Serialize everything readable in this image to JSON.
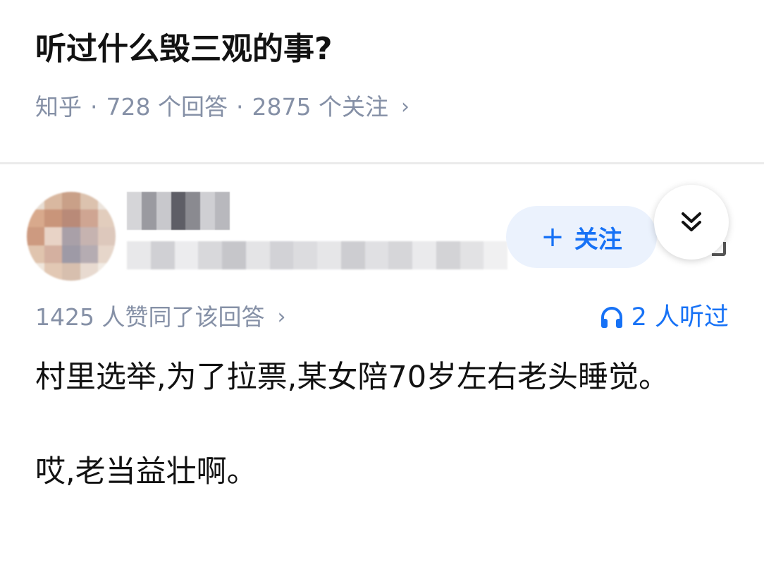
{
  "question": {
    "title": "听过什么毁三观的事?",
    "source": "知乎",
    "dot": "·",
    "answer_count": "728 个回答",
    "follower_count": "2875 个关注",
    "chevron": "›"
  },
  "author": {
    "follow_label": "关注",
    "follow_icon": "plus-icon",
    "collapse_icon": "double-chevron-down-icon"
  },
  "stats": {
    "votes_text": "1425 人赞同了该回答",
    "chevron": "›",
    "listen_icon": "headphones-icon",
    "listen_text": "2 人听过"
  },
  "answer": {
    "paragraphs": [
      "村里选举,为了拉票,某女陪70岁左右老头睡觉。",
      "哎,老当益壮啊。"
    ]
  },
  "colors": {
    "accent": "#1772f6",
    "follow_bg": "#ebf2fd",
    "meta_gray": "#8590a6",
    "text": "#121212"
  }
}
